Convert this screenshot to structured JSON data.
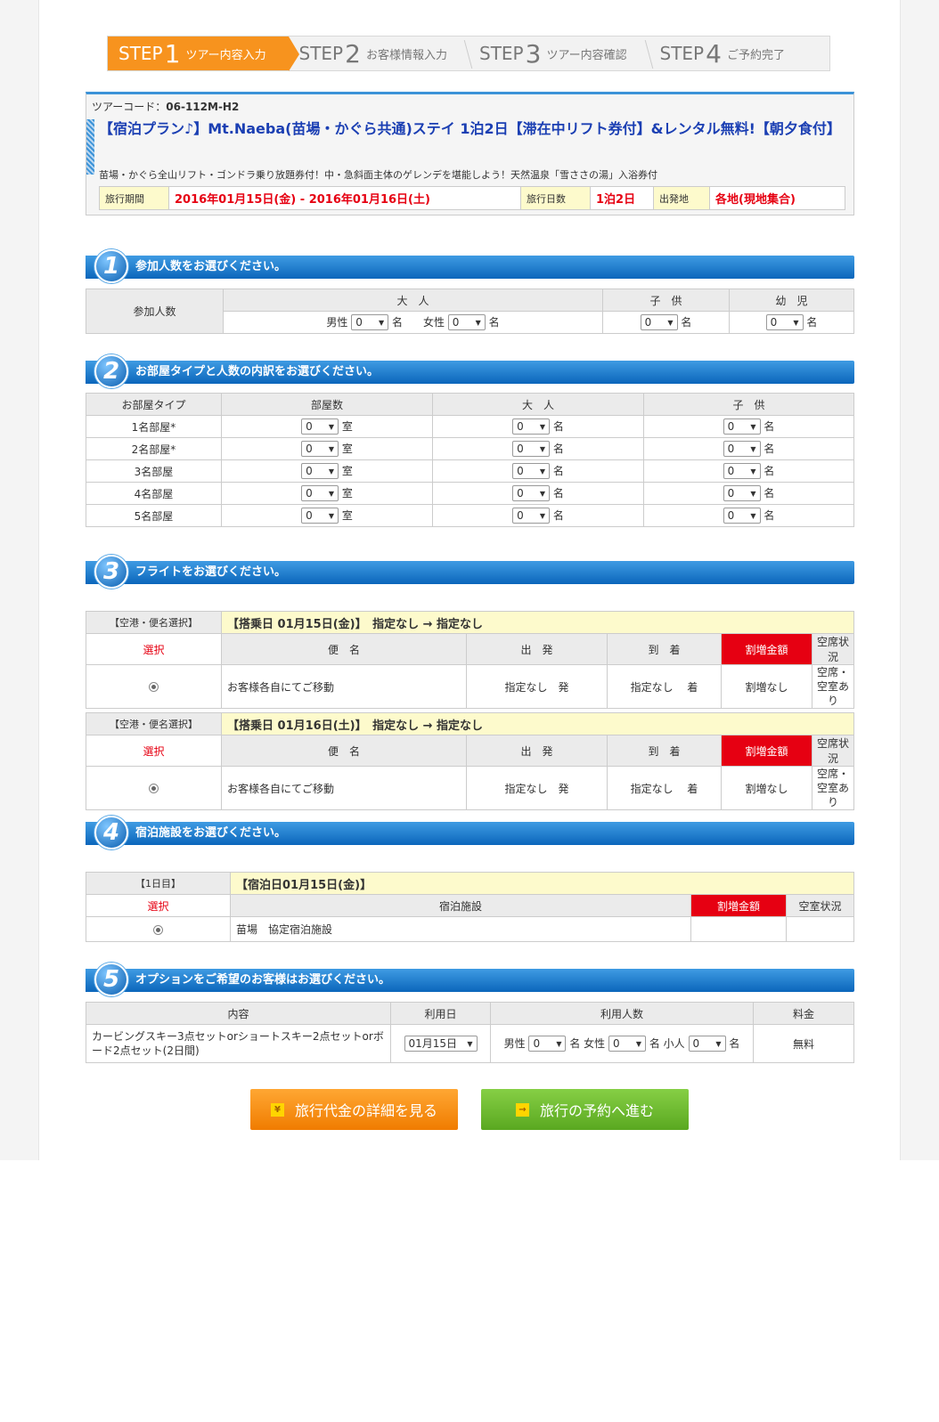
{
  "steps": [
    {
      "label": "STEP",
      "num": "1",
      "text": "ツアー内容入力"
    },
    {
      "label": "STEP",
      "num": "2",
      "text": "お客様情報入力"
    },
    {
      "label": "STEP",
      "num": "3",
      "text": "ツアー内容確認"
    },
    {
      "label": "STEP",
      "num": "4",
      "text": "ご予約完了"
    }
  ],
  "tour": {
    "code_label": "ツアーコード：",
    "code": "06-112M-H2",
    "title": "【宿泊プラン♪】Mt.Naeba(苗場・かぐら共通)ステイ 1泊2日【滞在中リフト券付】&レンタル無料!【朝夕食付】",
    "subtitle": "苗場・かぐら全山リフト・ゴンドラ乗り放題券付！中・急斜面主体のゲレンデを堪能しよう！天然温泉「雪ささの湯」入浴券付",
    "period_label": "旅行期間",
    "period": "2016年01月15日(金) - 2016年01月16日(土)",
    "days_label": "旅行日数",
    "days": "1泊2日",
    "departure_label": "出発地",
    "departure": "各地(現地集合)"
  },
  "sections": [
    {
      "num": "1",
      "title": "参加人数をお選びください。"
    },
    {
      "num": "2",
      "title": "お部屋タイプと人数の内訳をお選びください。"
    },
    {
      "num": "3",
      "title": "フライトをお選びください。"
    },
    {
      "num": "4",
      "title": "宿泊施設をお選びください。"
    },
    {
      "num": "5",
      "title": "オプションをご希望のお客様はお選びください。"
    }
  ],
  "participants": {
    "row_label": "参加人数",
    "adult": "大　人",
    "child": "子　供",
    "infant": "幼　児",
    "male": "男性",
    "female": "女性",
    "unit": "名",
    "value": "0"
  },
  "rooms": {
    "headers": [
      "お部屋タイプ",
      "部屋数",
      "大　人",
      "子　供"
    ],
    "types": [
      "1名部屋*",
      "2名部屋*",
      "3名部屋",
      "4名部屋",
      "5名部屋"
    ],
    "room_unit": "室",
    "person_unit": "名",
    "value": "0"
  },
  "flights": [
    {
      "label": "【空港・便名選択】",
      "date": "【搭乗日 01月15日(金)】　指定なし → 指定なし",
      "headers": [
        "選択",
        "便　名",
        "出　発",
        "到　着",
        "割増金額",
        "空席状況"
      ],
      "name": "お客様各自にてご移動",
      "dep": "指定なし　発",
      "arr": "指定なし　 着",
      "extra": "割増なし",
      "status": "空席・空室あり"
    },
    {
      "label": "【空港・便名選択】",
      "date": "【搭乗日 01月16日(土)】　指定なし → 指定なし",
      "headers": [
        "選択",
        "便　名",
        "出　発",
        "到　着",
        "割増金額",
        "空席状況"
      ],
      "name": "お客様各自にてご移動",
      "dep": "指定なし　発",
      "arr": "指定なし　 着",
      "extra": "割増なし",
      "status": "空席・空室あり"
    }
  ],
  "hotel": {
    "day": "【1日目】",
    "date": "【宿泊日01月15日(金)】",
    "headers": [
      "選択",
      "宿泊施設",
      "割増金額",
      "空室状況"
    ],
    "name": "苗場　協定宿泊施設"
  },
  "options": {
    "headers": [
      "内容",
      "利用日",
      "利用人数",
      "料金"
    ],
    "content": "カービングスキー3点セットorショートスキー2点セットorボード2点セット(2日間)",
    "date": "01月15日",
    "male": "男性",
    "female": "女性",
    "kid": "小人",
    "unit": "名",
    "value": "0",
    "price": "無料"
  },
  "buttons": {
    "detail": "旅行代金の詳細を見る",
    "detail_icon": "¥",
    "proceed": "旅行の予約へ進む",
    "proceed_icon": "→"
  },
  "colors": {
    "accent": "#f7931e",
    "header_blue": "#0b66bb",
    "price_red": "#e60012",
    "green": "#6ab82b"
  }
}
